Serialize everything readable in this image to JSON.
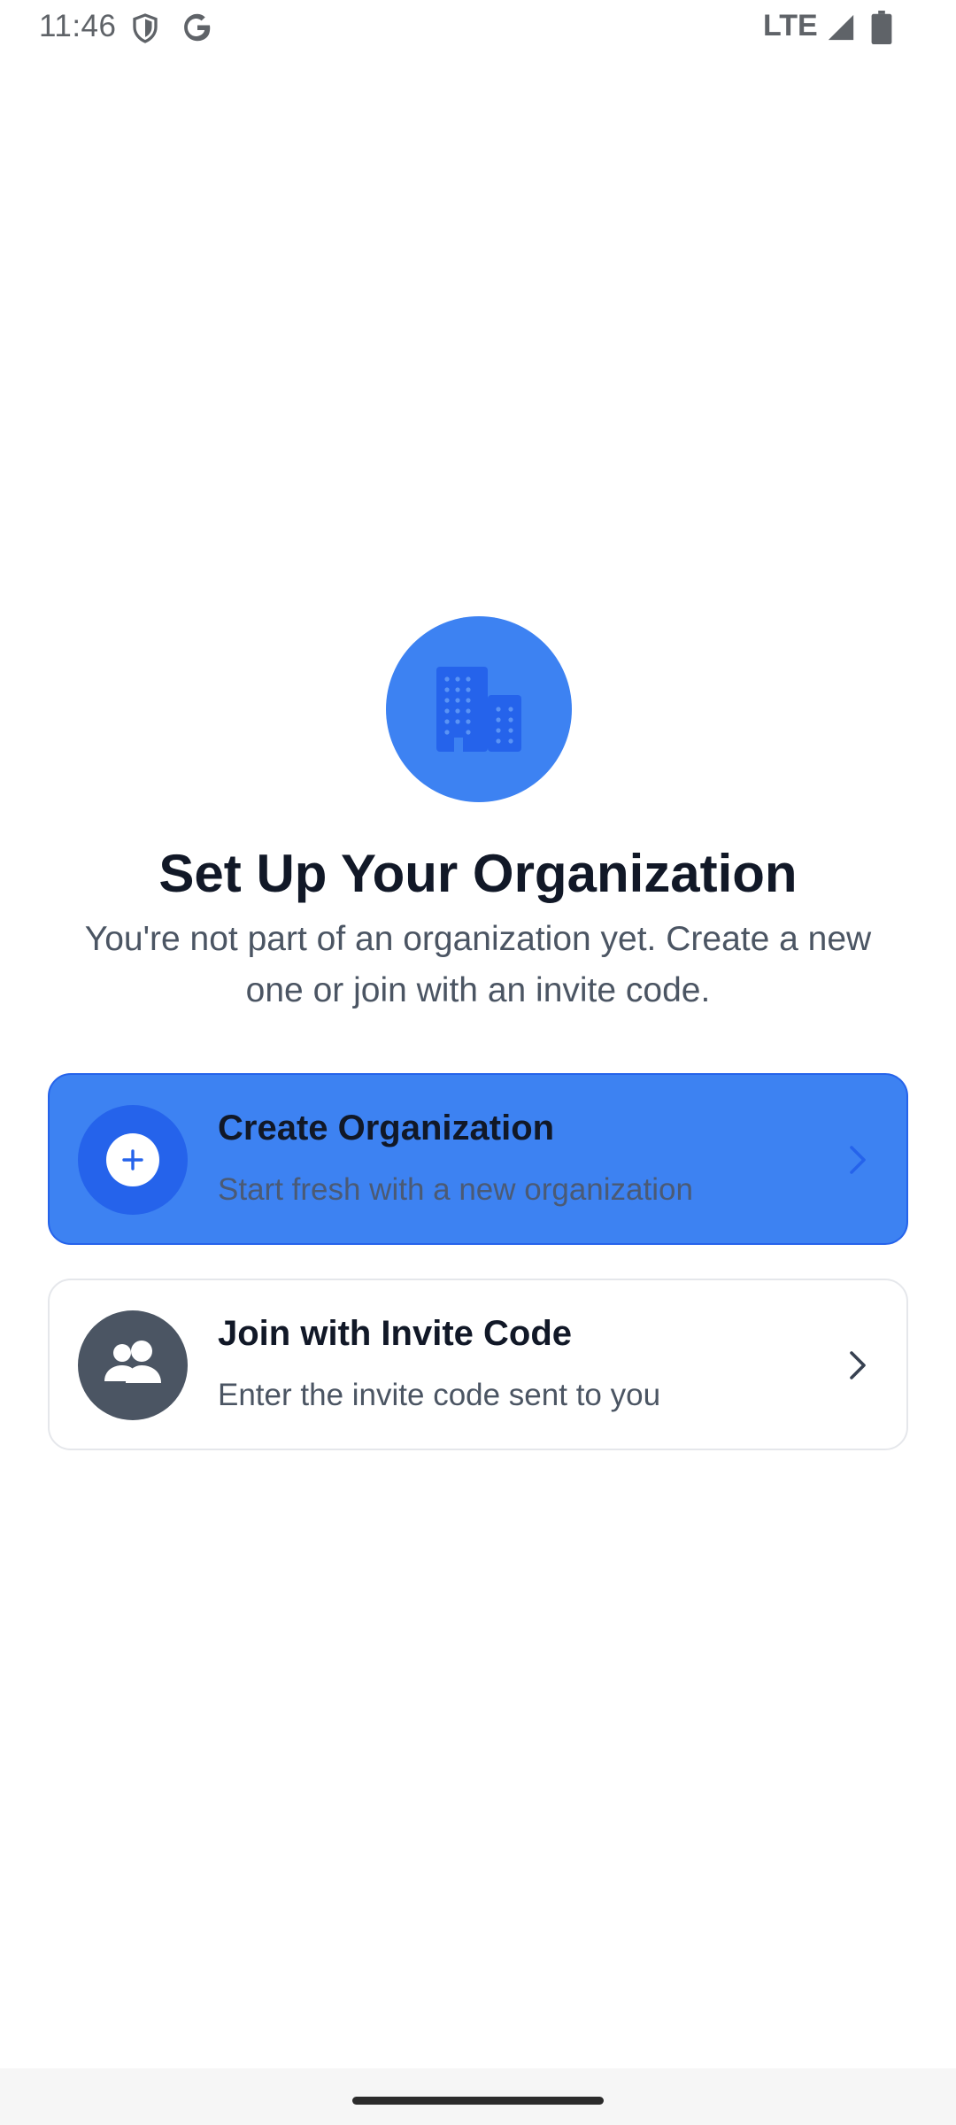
{
  "status_bar": {
    "time": "11:46",
    "network": "LTE",
    "icons": [
      "shield-icon",
      "google-icon",
      "signal-icon",
      "battery-icon"
    ]
  },
  "hero": {
    "icon": "building-icon",
    "title": "Set Up Your Organization",
    "subtitle": "You're not part of an organization yet. Create a new one or join with an invite code."
  },
  "options": {
    "create": {
      "icon": "plus-icon",
      "title": "Create Organization",
      "description": "Start fresh with a new organization"
    },
    "join": {
      "icon": "people-icon",
      "title": "Join with Invite Code",
      "description": "Enter the invite code sent to you"
    }
  },
  "colors": {
    "primary": "#3d82f2",
    "primary_dark": "#2563eb",
    "text_dark": "#111827",
    "text_muted": "#4b5563",
    "gray_icon_bg": "#4b5563"
  }
}
